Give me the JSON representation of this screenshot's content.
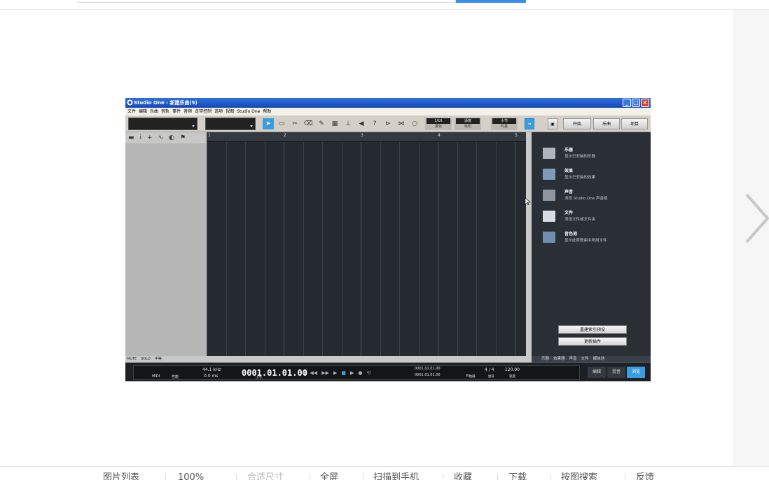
{
  "window": {
    "title": "Studio One - 新建乐曲(5)",
    "menu": [
      "文件",
      "编辑",
      "乐曲",
      "音轨",
      "事件",
      "音频",
      "走带控制",
      "选项",
      "视图",
      "Studio One",
      "帮助"
    ],
    "toolbar": {
      "quantize_value": "1/16",
      "quantize_label": "量化",
      "snap_value": "适度",
      "snap_label": "吸附",
      "timebase_value": "小节",
      "timebase_label": "时基",
      "start_button": "开始",
      "song_button": "乐曲",
      "project_button": "项目"
    },
    "ruler_marks": [
      "1",
      "2",
      "3",
      "4",
      "5"
    ],
    "left_panel": {
      "mute_label": "MUTE",
      "solo_label": "SOLO",
      "middle_label": "中等"
    },
    "browser": {
      "items": [
        {
          "title": "乐器",
          "desc": "显示已安装的乐器"
        },
        {
          "title": "效果",
          "desc": "显示已安装的效果"
        },
        {
          "title": "声音",
          "desc": "浏览 Studio One 声音组"
        },
        {
          "title": "文件",
          "desc": "浏览文件或文件夹"
        },
        {
          "title": "音色池",
          "desc": "显示此首歌曲中所用文件"
        }
      ],
      "rebuild_button": "重建索引预设",
      "update_button": "更新插件",
      "tabs": [
        "乐器",
        "效果器",
        "声音",
        "文件",
        "媒体池"
      ]
    },
    "transport": {
      "midi_label": "MIDI",
      "perf_label": "性能",
      "sample_rate": "44.1 kHz",
      "latency": "0.0 ms",
      "time": "0001.01.01.00",
      "time_unit": "小节",
      "loop_start": "0001.01.01.00",
      "loop_end": "0001.01.01.00",
      "metronome_label": "节拍器",
      "signature": "4 / 4",
      "signature_label": "拍号",
      "tempo": "120.00",
      "tempo_label": "速度",
      "edit_button": "编辑",
      "mix_button": "混音",
      "browse_button": "浏览"
    }
  },
  "bottombar": {
    "items": [
      "图片列表",
      "100%",
      "合适尺寸",
      "全屏",
      "扫描到手机",
      "收藏",
      "下载",
      "按图搜索",
      "反馈"
    ]
  }
}
